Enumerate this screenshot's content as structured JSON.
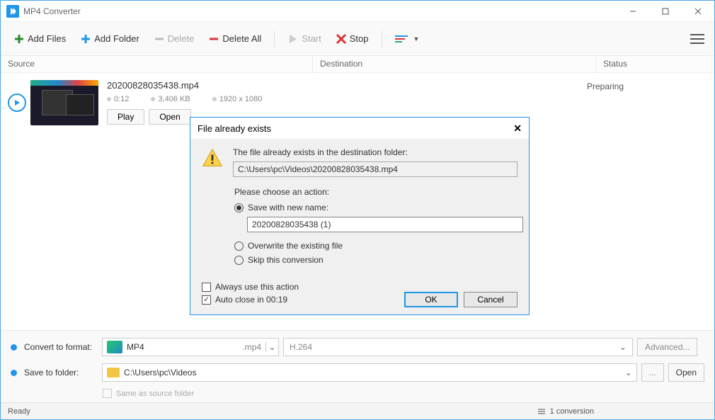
{
  "window": {
    "title": "MP4 Converter"
  },
  "toolbar": {
    "add_files": "Add Files",
    "add_folder": "Add Folder",
    "delete": "Delete",
    "delete_all": "Delete All",
    "start": "Start",
    "stop": "Stop"
  },
  "columns": {
    "source": "Source",
    "destination": "Destination",
    "status": "Status"
  },
  "item": {
    "filename": "20200828035438.mp4",
    "duration": "0:12",
    "size": "3,406 KB",
    "resolution": "1920 x 1080",
    "play_btn": "Play",
    "open_btn": "Open",
    "status": "Preparing"
  },
  "bottom": {
    "convert_label": "Convert to format:",
    "format": "MP4",
    "ext": ".mp4",
    "codec": "H.264",
    "advanced": "Advanced...",
    "save_label": "Save to folder:",
    "folder": "C:\\Users\\pc\\Videos",
    "browse": "...",
    "open": "Open",
    "same_source": "Same as source folder"
  },
  "statusbar": {
    "ready": "Ready",
    "conversions": "1 conversion"
  },
  "dialog": {
    "title": "File already exists",
    "message": "The file already exists in the destination folder:",
    "path": "C:\\Users\\pc\\Videos\\20200828035438.mp4",
    "prompt": "Please choose an action:",
    "opt_save": "Save with new name:",
    "new_name": "20200828035438 (1)",
    "opt_overwrite": "Overwrite the existing file",
    "opt_skip": "Skip this conversion",
    "always": "Always use this action",
    "autoclose": "Auto close in 00:19",
    "ok": "OK",
    "cancel": "Cancel"
  }
}
